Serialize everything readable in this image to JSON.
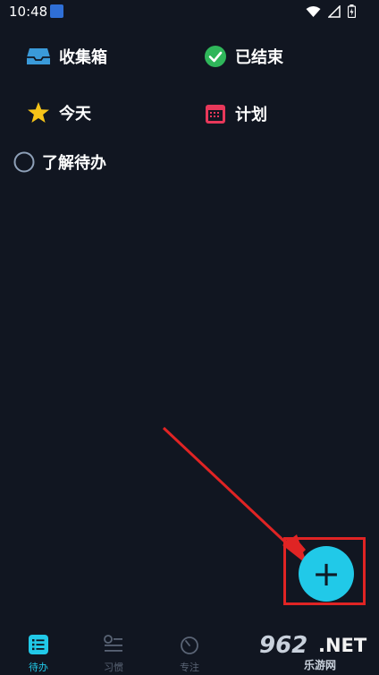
{
  "status_bar": {
    "time": "10:48"
  },
  "menu": {
    "items": [
      {
        "label": "收集箱",
        "icon": "inbox-icon"
      },
      {
        "label": "已结束",
        "icon": "check-circle-icon"
      },
      {
        "label": "今天",
        "icon": "star-icon"
      },
      {
        "label": "计划",
        "icon": "calendar-icon"
      },
      {
        "label": "了解待办",
        "icon": "circle-icon"
      }
    ]
  },
  "fab": {
    "icon": "plus-icon",
    "label": "+"
  },
  "bottom_nav": {
    "items": [
      {
        "label": "待办",
        "icon": "list-icon",
        "active": true
      },
      {
        "label": "习惯",
        "icon": "habit-icon",
        "active": false
      },
      {
        "label": "专注",
        "icon": "timer-icon",
        "active": false
      }
    ]
  },
  "watermark": {
    "number": "962",
    "suffix": ".NET",
    "sub": "乐游网"
  },
  "colors": {
    "background": "#111621",
    "accent": "#21c9e8",
    "annotation": "#e02424",
    "check_green": "#2fb65a",
    "star_yellow": "#f5c318",
    "calendar_red": "#e8385a"
  }
}
